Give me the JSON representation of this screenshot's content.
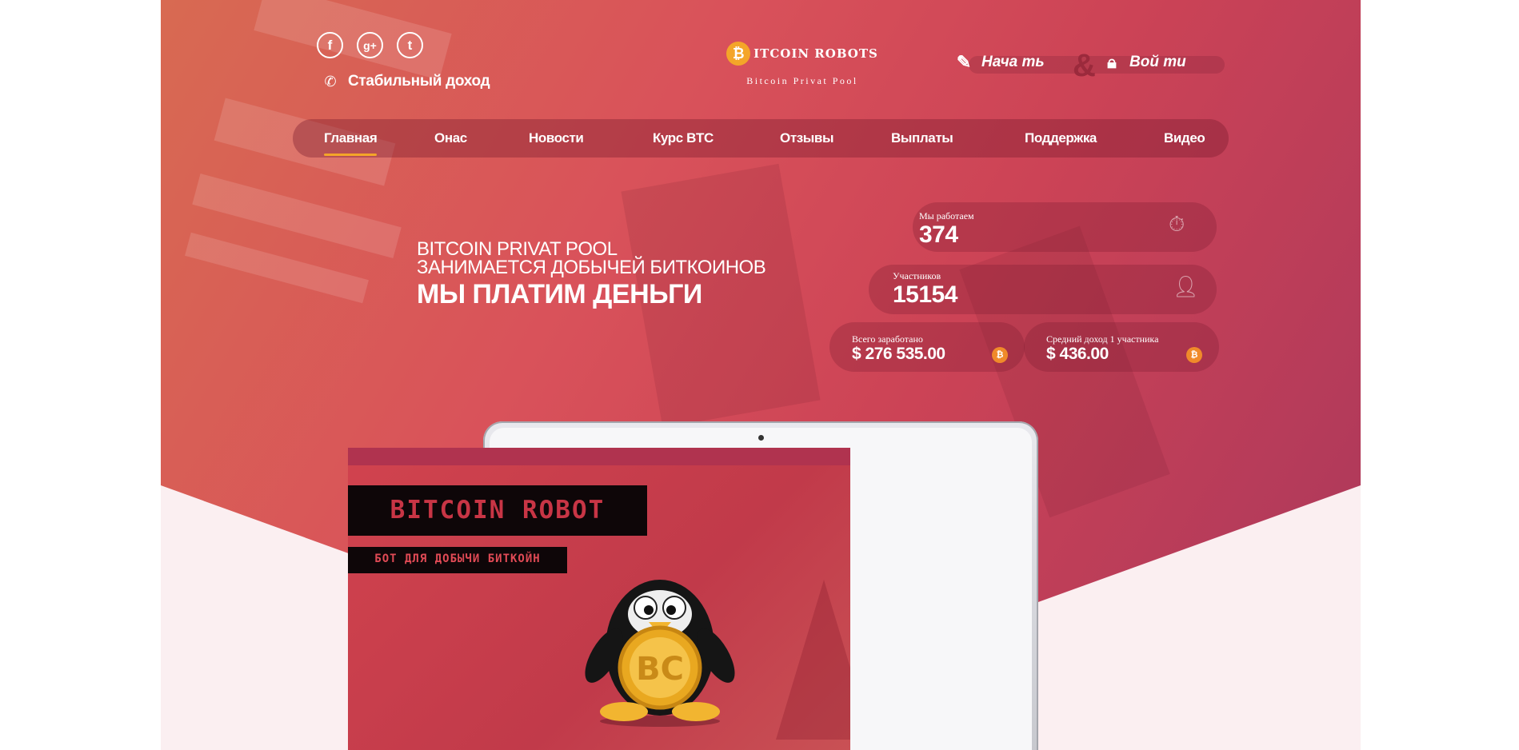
{
  "header": {
    "social": [
      {
        "name": "facebook-icon",
        "glyph": "f"
      },
      {
        "name": "google-plus-icon",
        "glyph": "g+"
      },
      {
        "name": "twitter-icon",
        "glyph": "t"
      }
    ],
    "slogan": "Стабильный доход",
    "logo_title": "ITCOIN ROBOTS",
    "logo_sub": "Bitcoin Privat Pool",
    "start_label": "Нача ть",
    "ampersand": "&",
    "login_label": "Вой ти"
  },
  "nav": {
    "items": [
      "Главная",
      "Онас",
      "Новости",
      "Курс BTC",
      "Отзывы",
      "Выплаты",
      "Поддержка",
      "Видео"
    ],
    "active": "Главная"
  },
  "hero": {
    "line1": "BITCOIN PRIVAT POOL",
    "line2": "ЗАНИМАЕТСЯ ДОБЫЧЕЙ БИТКОИНОВ",
    "line3": "МЫ ПЛАТИМ ДЕНЬГИ"
  },
  "stats": {
    "days_label": "Мы работаем",
    "days_value": "374",
    "members_label": "Участников",
    "members_value": "15154",
    "total_label": "Всего заработано",
    "total_value": "$ 276 535.00",
    "avg_label": "Средний доход 1 участника",
    "avg_value": "$ 436.00"
  },
  "screen": {
    "banner_title": "BITCOIN ROBOT",
    "banner_sub": "БОТ ДЛЯ ДОБЫЧИ БИТКОЙН",
    "coin_text": "BC"
  },
  "colors": {
    "accent": "#f4a529",
    "hero_start": "#d86a52",
    "hero_end": "#a9375c"
  }
}
